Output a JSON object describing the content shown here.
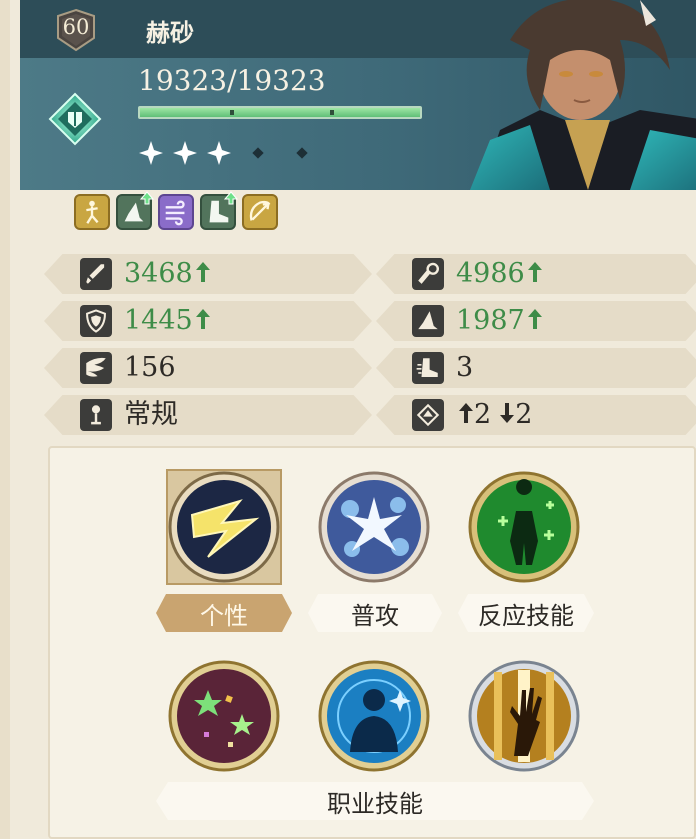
{
  "character": {
    "level": "60",
    "name": "赫砂",
    "hp": "19323/19323",
    "hp_fraction": 1.0,
    "stars_filled": 3,
    "stars_total": 5,
    "class_icon": "lance-emblem-icon"
  },
  "tags": [
    {
      "icon": "dance-figure-icon",
      "color": "gold",
      "upgraded": false
    },
    {
      "icon": "wizard-hat-icon",
      "color": "green",
      "upgraded": true
    },
    {
      "icon": "wind-gust-icon",
      "color": "purple",
      "upgraded": false
    },
    {
      "icon": "boot-icon",
      "color": "green",
      "upgraded": true
    },
    {
      "icon": "bow-arrow-icon",
      "color": "gold",
      "upgraded": false
    }
  ],
  "stats": {
    "attack": {
      "value": "3468",
      "boosted": true,
      "icon": "sword-icon"
    },
    "magic_attack": {
      "value": "4986",
      "boosted": true,
      "icon": "staff-icon"
    },
    "defense": {
      "value": "1445",
      "boosted": true,
      "icon": "shield-icon"
    },
    "magic_defense": {
      "value": "1987",
      "boosted": true,
      "icon": "wizard-hat-icon"
    },
    "speed": {
      "value": "156",
      "boosted": false,
      "icon": "wing-icon"
    },
    "movement": {
      "value": "3",
      "boosted": false,
      "icon": "boot-icon"
    },
    "attack_type": {
      "value": "常规",
      "boosted": false,
      "icon": "target-icon"
    },
    "height": {
      "up": "2",
      "down": "2",
      "icon": "elevation-icon"
    }
  },
  "skills": {
    "labels": {
      "trait": "个性",
      "normal_attack": "普攻",
      "reaction": "反应技能",
      "class_skills": "职业技能"
    },
    "selected": "trait"
  },
  "colors": {
    "header": "#3f6a77",
    "stat_green": "#3e8c48",
    "hp_green": "#6cc97f",
    "gold": "#c9a642"
  }
}
